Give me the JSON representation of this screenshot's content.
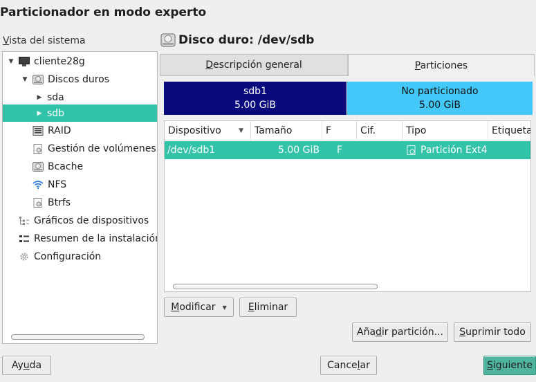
{
  "window": {
    "title": "Particionador en modo experto"
  },
  "tree": {
    "label": "Vista del sistema",
    "items": [
      {
        "label": "cliente28g",
        "icon": "computer-icon"
      },
      {
        "label": "Discos duros",
        "icon": "harddisk-icon"
      },
      {
        "label": "sda",
        "icon": ""
      },
      {
        "label": "sdb",
        "icon": ""
      },
      {
        "label": "RAID",
        "icon": "raid-icon"
      },
      {
        "label": "Gestión de volúmenes",
        "icon": "volume-icon"
      },
      {
        "label": "Bcache",
        "icon": "harddisk-icon"
      },
      {
        "label": "NFS",
        "icon": "wifi-icon"
      },
      {
        "label": "Btrfs",
        "icon": "volume-icon"
      },
      {
        "label": "Gráficos de dispositivos",
        "icon": "graph-icon"
      },
      {
        "label": "Resumen de la instalación",
        "icon": "list-icon"
      },
      {
        "label": "Configuración",
        "icon": "gear-icon"
      }
    ]
  },
  "disk": {
    "title": "Disco duro: /dev/sdb"
  },
  "tabs": {
    "general": "Descripción general",
    "partitions": "Particiones"
  },
  "bars": {
    "part_name": "sdb1",
    "part_size": "5.00 GiB",
    "free_name": "No particionado",
    "free_size": "5.00 GiB",
    "colors": {
      "partition": "#080a7e",
      "free": "#43c8f9"
    }
  },
  "table": {
    "headers": {
      "device": "Dispositivo",
      "size": "Tamaño",
      "format": "F",
      "encrypted": "Cif.",
      "type": "Tipo",
      "label": "Etiqueta"
    },
    "rows": [
      {
        "device": "/dev/sdb1",
        "size": "5.00 GiB",
        "format": "F",
        "encrypted": "",
        "type": "Partición Ext4"
      }
    ]
  },
  "buttons": {
    "modify": "Modificar",
    "delete": "Eliminar",
    "add_partition": "Añadir partición...",
    "delete_all": "Suprimir todo",
    "help": "Ayuda",
    "cancel": "Cancelar",
    "next": "Siguiente"
  },
  "colors": {
    "selection": "#33c3a8",
    "primary": "#4fb49d"
  }
}
